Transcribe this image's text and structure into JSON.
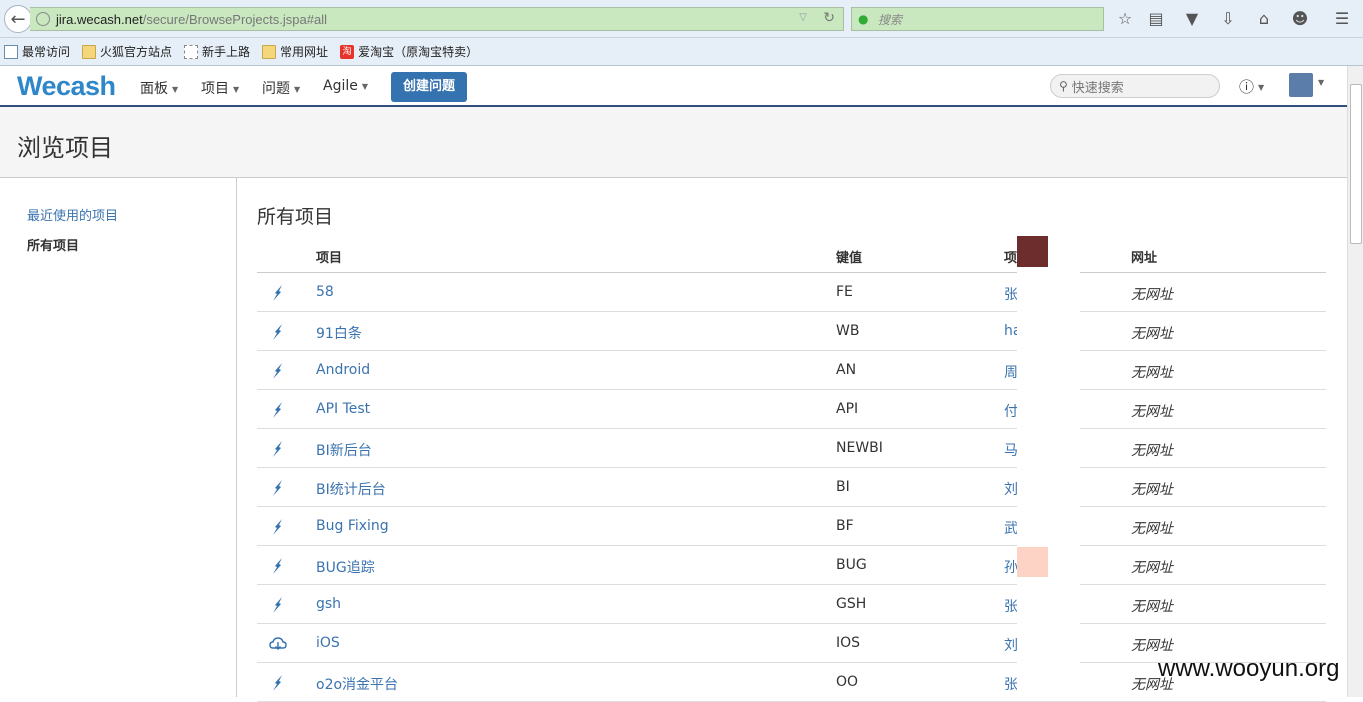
{
  "browser": {
    "url_host": "jira.wecash.net",
    "url_path": "/secure/BrowseProjects.jspa#all",
    "search_placeholder": "搜索",
    "bookmarks": [
      {
        "label": "最常访问",
        "icon": "doc"
      },
      {
        "label": "火狐官方站点",
        "icon": "folder"
      },
      {
        "label": "新手上路",
        "icon": "dashed"
      },
      {
        "label": "常用网址",
        "icon": "folder"
      },
      {
        "label": "爱淘宝（原淘宝特卖）",
        "icon": "taobao",
        "icon_text": "淘"
      }
    ]
  },
  "header": {
    "logo": "Wecash",
    "menus": [
      "面板",
      "项目",
      "问题",
      "Agile"
    ],
    "create_button": "创建问题",
    "quick_search_placeholder": "快速搜索"
  },
  "page": {
    "title": "浏览项目"
  },
  "sidebar": {
    "items": [
      {
        "label": "最近使用的项目"
      },
      {
        "label": "所有项目"
      }
    ]
  },
  "main": {
    "section_title": "所有项目",
    "columns": [
      "项目",
      "键值",
      "项",
      "网址"
    ],
    "rows": [
      {
        "icon": "rocket",
        "name": "58",
        "key": "FE",
        "lead": "张",
        "url": "无网址"
      },
      {
        "icon": "rocket",
        "name": "91白条",
        "key": "WB",
        "lead": "ha",
        "url": "无网址"
      },
      {
        "icon": "rocket",
        "name": "Android",
        "key": "AN",
        "lead": "周",
        "url": "无网址"
      },
      {
        "icon": "rocket",
        "name": "API Test",
        "key": "API",
        "lead": "付",
        "url": "无网址"
      },
      {
        "icon": "rocket",
        "name": "BI新后台",
        "key": "NEWBI",
        "lead": "马",
        "url": "无网址"
      },
      {
        "icon": "rocket",
        "name": "BI统计后台",
        "key": "BI",
        "lead": "刘",
        "url": "无网址"
      },
      {
        "icon": "rocket",
        "name": "Bug Fixing",
        "key": "BF",
        "lead": "武",
        "url": "无网址"
      },
      {
        "icon": "rocket",
        "name": "BUG追踪",
        "key": "BUG",
        "lead": "孙",
        "url": "无网址"
      },
      {
        "icon": "rocket",
        "name": "gsh",
        "key": "GSH",
        "lead": "张",
        "url": "无网址"
      },
      {
        "icon": "cloud",
        "name": "iOS",
        "key": "IOS",
        "lead": "刘",
        "url": "无网址"
      },
      {
        "icon": "rocket",
        "name": "o2o消金平台",
        "key": "OO",
        "lead": "张",
        "url": "无网址"
      }
    ]
  },
  "watermark": "www.wooyun.org"
}
